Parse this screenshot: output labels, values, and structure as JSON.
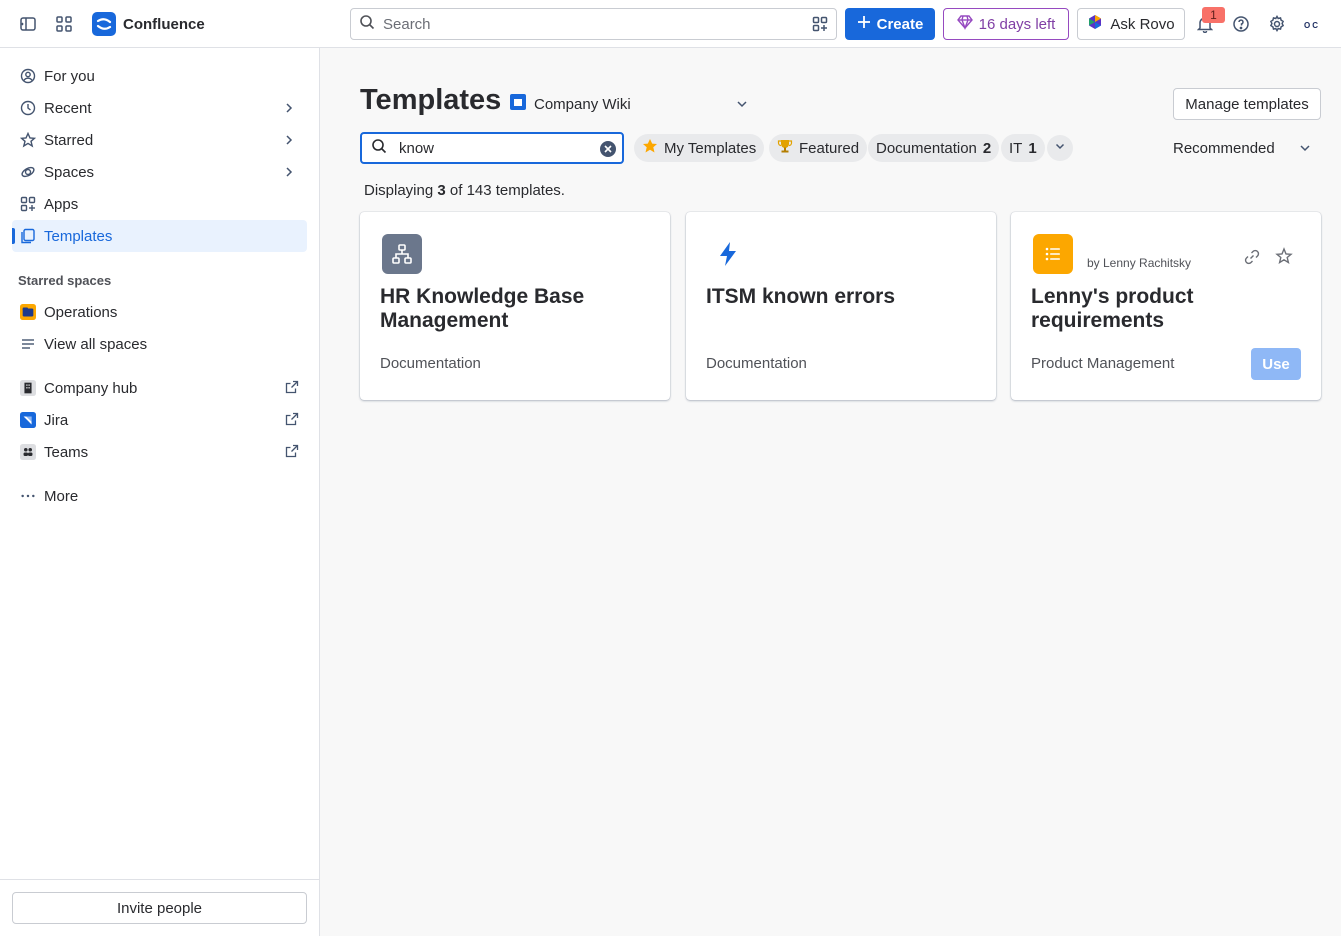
{
  "app": {
    "name": "Confluence",
    "brand_color": "#1868DB"
  },
  "topbar": {
    "search_placeholder": "Search",
    "create_label": "Create",
    "trial_label": "16 days left",
    "rovo_label": "Ask Rovo",
    "notification_count": "1",
    "avatar_text": "OC"
  },
  "sidebar": {
    "items": [
      {
        "label": "For you",
        "icon": "user-circle-icon"
      },
      {
        "label": "Recent",
        "icon": "clock-icon"
      },
      {
        "label": "Starred",
        "icon": "star-icon"
      },
      {
        "label": "Spaces",
        "icon": "spaces-icon"
      },
      {
        "label": "Apps",
        "icon": "apps-icon"
      },
      {
        "label": "Templates",
        "icon": "template-icon",
        "active": true
      }
    ],
    "starred_spaces_label": "Starred spaces",
    "starred_spaces": [
      {
        "label": "Operations",
        "icon": "operations-space-icon"
      },
      {
        "label": "View all spaces",
        "icon": "list-icon"
      }
    ],
    "external_links": [
      {
        "label": "Company hub",
        "icon": "company-hub-icon"
      },
      {
        "label": "Jira",
        "icon": "jira-icon"
      },
      {
        "label": "Teams",
        "icon": "teams-icon"
      }
    ],
    "more_label": "More",
    "invite_label": "Invite people"
  },
  "main": {
    "title": "Templates",
    "space_name": "Company Wiki",
    "manage_label": "Manage templates",
    "search_value": "know",
    "filters": [
      {
        "label": "My Templates",
        "icon": "star-filled-icon"
      },
      {
        "label": "Featured",
        "icon": "trophy-icon"
      },
      {
        "label": "Documentation",
        "count": "2"
      },
      {
        "label": "IT",
        "count": "1"
      }
    ],
    "sort_label": "Recommended",
    "display_prefix": "Displaying ",
    "display_shown": "3",
    "display_suffix": " of 143 templates.",
    "cards": [
      {
        "title": "HR Knowledge Base Management",
        "category": "Documentation",
        "icon": "hierarchy-icon",
        "icon_bg": "#6B778C"
      },
      {
        "title": "ITSM known errors",
        "category": "Documentation",
        "icon": "lightning-icon"
      },
      {
        "title": "Lenny's product requirements",
        "category": "Product Management",
        "author": "by Lenny Rachitsky",
        "icon": "list-icon",
        "icon_bg": "#FCA700",
        "use_label": "Use"
      }
    ]
  }
}
